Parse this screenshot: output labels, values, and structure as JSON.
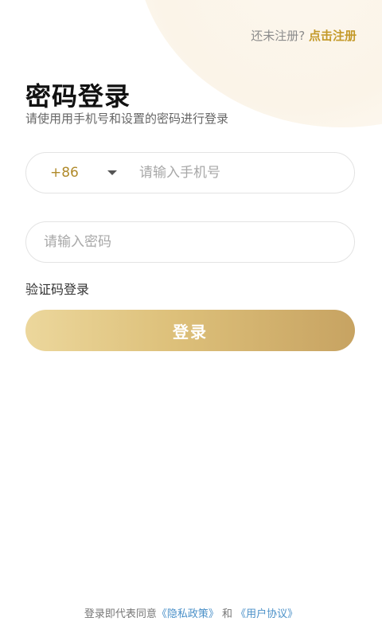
{
  "header": {
    "register_prompt": "还未注册?",
    "register_link": "点击注册"
  },
  "title": "密码登录",
  "subtitle": "请使用用手机号和设置的密码进行登录",
  "phone": {
    "country_code": "+86",
    "placeholder": "请输入手机号"
  },
  "password": {
    "placeholder": "请输入密码"
  },
  "code_login_label": "验证码登录",
  "login_button": "登录",
  "agreement": {
    "prefix": "登录即代表同意",
    "privacy_link": "《隐私政策》",
    "and": "和",
    "user_link": "《用户协议》"
  },
  "colors": {
    "accent": "#c49a2a",
    "button_gradient_start": "#ecd79c",
    "button_gradient_end": "#c7a362",
    "link_blue": "#4a90c8"
  }
}
